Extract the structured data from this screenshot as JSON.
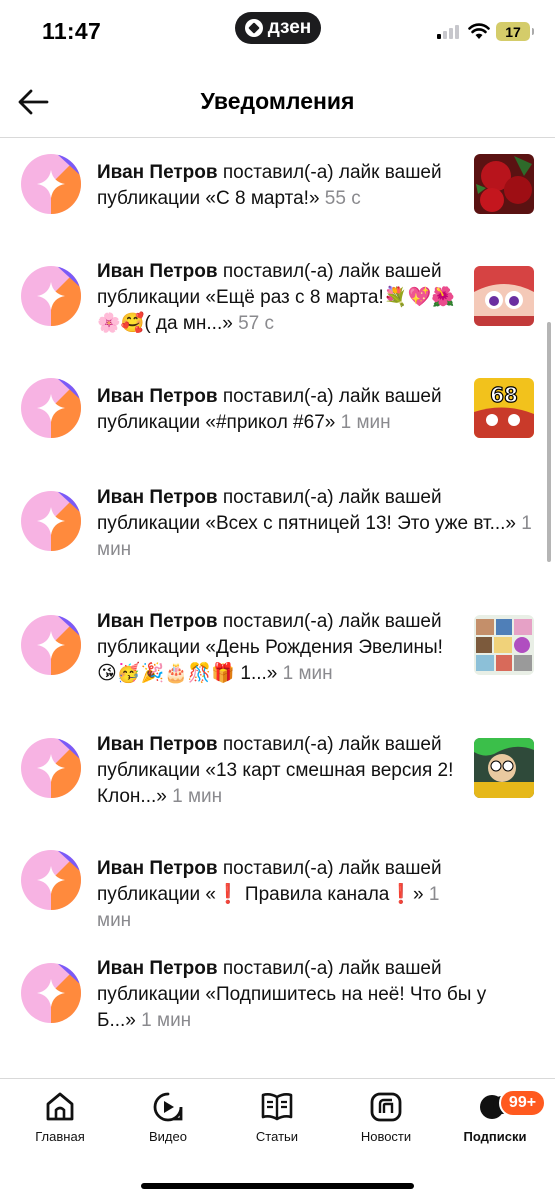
{
  "status_bar": {
    "time": "11:47",
    "brand_pill": "дзен",
    "battery_level": "17",
    "icons": [
      "signal-icon",
      "wifi-icon",
      "battery-icon"
    ]
  },
  "header": {
    "title": "Уведомления",
    "back_icon": "arrow-left-icon"
  },
  "notifications": [
    {
      "actor": "Иван Петров",
      "action": " поставил(-а) лайк вашей публикации «С 8 марта!» ",
      "time": "55 с",
      "has_thumb": true
    },
    {
      "actor": "Иван Петров",
      "action": " поставил(-а) лайк вашей публикации «Ещё раз с 8 марта!💐💖🌺🌸🥰( да мн...» ",
      "time": "57 с",
      "has_thumb": true
    },
    {
      "actor": "Иван Петров",
      "action": " поставил(-а) лайк вашей публикации «#прикол #67» ",
      "time": "1 мин",
      "has_thumb": true,
      "thumb_text": "68"
    },
    {
      "actor": "Иван Петров",
      "action": " поставил(-а) лайк вашей публикации «Всех с пятницей 13! Это уже вт...» ",
      "time": "1 мин",
      "has_thumb": false
    },
    {
      "actor": "Иван Петров",
      "action": " поставил(-а) лайк вашей публикации «День Рождения Эвелины!😘🥳🎉🎂🎊🎁 1...» ",
      "time": "1 мин",
      "has_thumb": true
    },
    {
      "actor": "Иван Петров",
      "action": " поставил(-а) лайк вашей публикации «13 карт смешная версия 2! Клон...» ",
      "time": "1 мин",
      "has_thumb": true
    },
    {
      "actor": "Иван Петров",
      "action": " поставил(-а) лайк вашей публикации «❗ Правила канала❗» ",
      "time": "1 мин",
      "has_thumb": false
    },
    {
      "actor": "Иван Петров",
      "action": " поставил(-а) лайк вашей публикации «Подпишитесь на неё! Что бы у Б...» ",
      "time": "1 мин",
      "has_thumb": false
    }
  ],
  "bottom_nav": {
    "items": [
      {
        "label": "Главная",
        "icon": "home-icon"
      },
      {
        "label": "Видео",
        "icon": "play-icon"
      },
      {
        "label": "Статьи",
        "icon": "book-icon"
      },
      {
        "label": "Новости",
        "icon": "news-icon"
      },
      {
        "label": "Подписки",
        "icon": "subscriptions-icon",
        "active": true
      }
    ],
    "badge": "99+"
  },
  "colors": {
    "avatar_pink": "#f7b3e3",
    "avatar_orange": "#ff8a3d",
    "avatar_purple": "#7a5af8",
    "badge": "#ff5a1f",
    "muted_text": "#8a8a8e"
  }
}
